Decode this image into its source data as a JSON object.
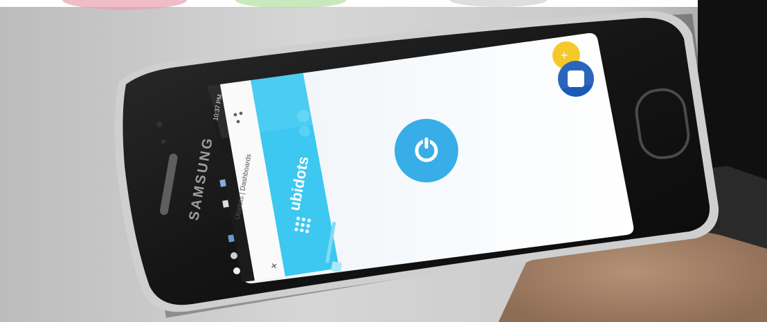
{
  "device": {
    "brand": "SAMSUNG",
    "status_time": "10:37 PM"
  },
  "browser": {
    "page_title": "Ubidots | Dashboards",
    "close_symbol": "×"
  },
  "app": {
    "logo_text": "ubidots",
    "header_color": "#3cc8f0",
    "button_color": "#38aee8",
    "accent_color": "#f5c518"
  },
  "icons": {
    "power": "power-icon",
    "menu": "grid-menu-icon",
    "share": "share-icon",
    "close": "close-icon",
    "stop": "stop-icon",
    "add": "add-icon",
    "home": "home-button"
  }
}
